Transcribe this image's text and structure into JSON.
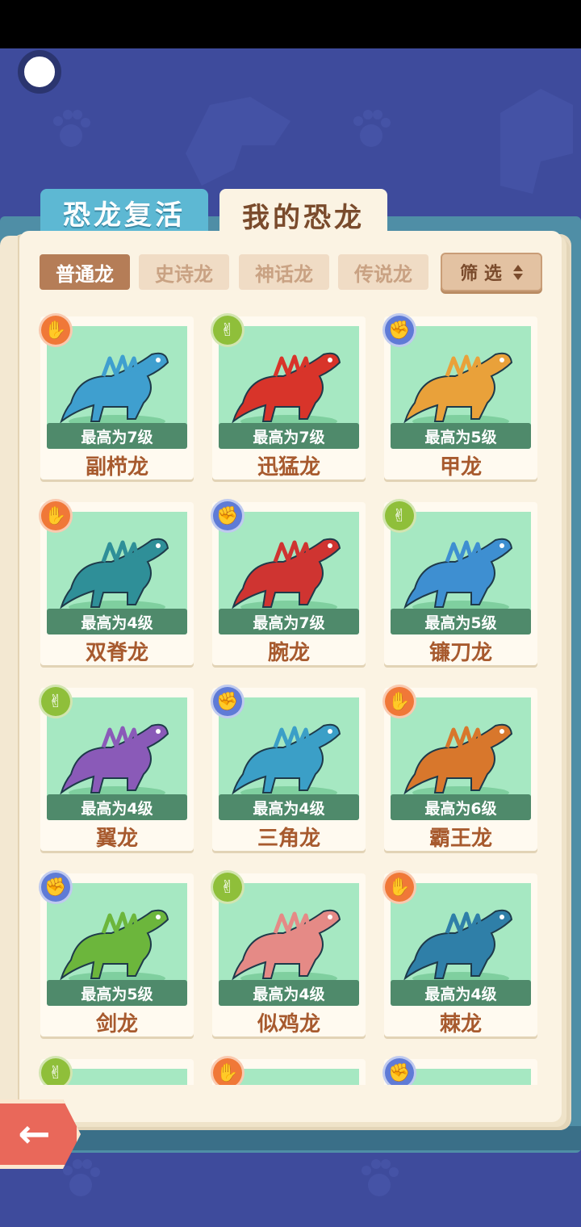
{
  "tabs": {
    "revive": "恐龙复活",
    "mine": "我的恐龙"
  },
  "rarity_filters": [
    {
      "label": "普通龙",
      "active": true
    },
    {
      "label": "史诗龙",
      "active": false
    },
    {
      "label": "神话龙",
      "active": false
    },
    {
      "label": "传说龙",
      "active": false
    }
  ],
  "sort_label": "筛 选",
  "badges": {
    "paper": "paper-hand-icon",
    "scissors": "scissors-hand-icon",
    "rock": "rock-fist-icon"
  },
  "dinosaurs": [
    {
      "name": "副栉龙",
      "level": "最高为7级",
      "badge": "paper",
      "color": "#3f9fcf"
    },
    {
      "name": "迅猛龙",
      "level": "最高为7级",
      "badge": "scissors",
      "color": "#d8342a"
    },
    {
      "name": "甲龙",
      "level": "最高为5级",
      "badge": "rock",
      "color": "#e9a13a"
    },
    {
      "name": "双脊龙",
      "level": "最高为4级",
      "badge": "paper",
      "color": "#2f8f98"
    },
    {
      "name": "腕龙",
      "level": "最高为7级",
      "badge": "rock",
      "color": "#cf3431"
    },
    {
      "name": "镰刀龙",
      "level": "最高为5级",
      "badge": "scissors",
      "color": "#3e8fd1"
    },
    {
      "name": "翼龙",
      "level": "最高为4级",
      "badge": "scissors",
      "color": "#8a5ab8"
    },
    {
      "name": "三角龙",
      "level": "最高为4级",
      "badge": "rock",
      "color": "#3b9fc7"
    },
    {
      "name": "霸王龙",
      "level": "最高为6级",
      "badge": "paper",
      "color": "#d8772c"
    },
    {
      "name": "剑龙",
      "level": "最高为5级",
      "badge": "rock",
      "color": "#6cb63c"
    },
    {
      "name": "似鸡龙",
      "level": "最高为4级",
      "badge": "scissors",
      "color": "#e58a86"
    },
    {
      "name": "棘龙",
      "level": "最高为4级",
      "badge": "paper",
      "color": "#2f7fa8"
    },
    {
      "name": "",
      "level": "",
      "badge": "scissors",
      "color": "#a6e8c2"
    },
    {
      "name": "",
      "level": "",
      "badge": "paper",
      "color": "#a6e8c2"
    },
    {
      "name": "",
      "level": "",
      "badge": "rock",
      "color": "#a6e8c2"
    }
  ]
}
